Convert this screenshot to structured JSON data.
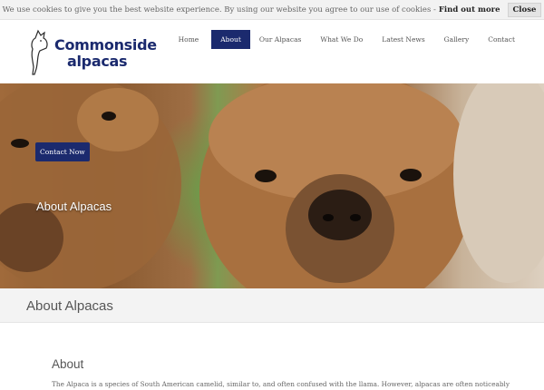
{
  "cookie_bar": {
    "message": "We use cookies to give you the best website experience. By using our website you agree to our use of cookies -",
    "link_label": "Find out more",
    "close_label": "Close"
  },
  "logo": {
    "line1": "Commonside",
    "line2": "alpacas"
  },
  "nav": {
    "items": [
      {
        "label": "Home"
      },
      {
        "label": "About",
        "active": true
      },
      {
        "label": "Our Alpacas"
      },
      {
        "label": "What We Do"
      },
      {
        "label": "Latest News"
      },
      {
        "label": "Gallery"
      },
      {
        "label": "Contact"
      }
    ]
  },
  "hero": {
    "title": "About Alpacas",
    "button_label": "Contact Now"
  },
  "page": {
    "title": "About Alpacas",
    "section_heading": "About",
    "section_text": "The Alpaca is a species of South American camelid, similar to, and often confused with the llama. However, alpacas are often noticeably"
  },
  "colors": {
    "brand": "#1b2a6e",
    "title_bar": "#f3f3f3"
  }
}
